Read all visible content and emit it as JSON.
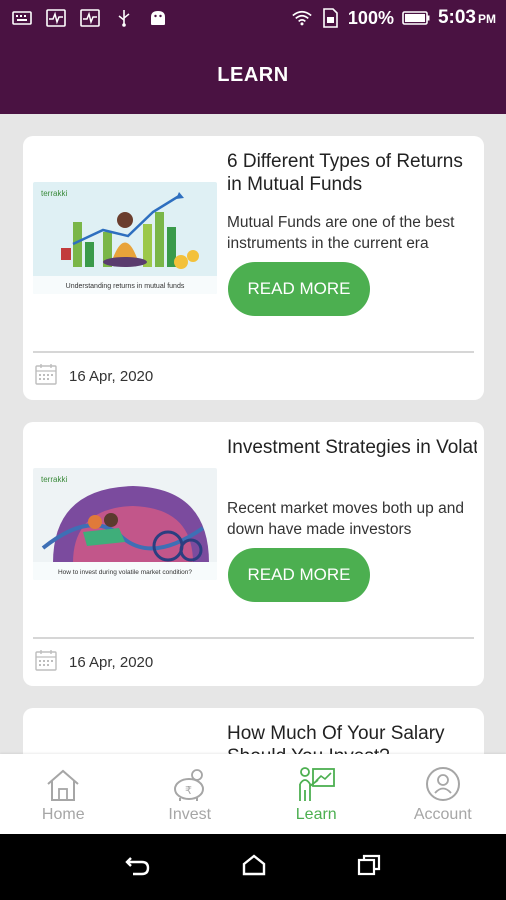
{
  "status_bar": {
    "battery": "100%",
    "time": "5:03",
    "ampm": "PM",
    "icons": [
      "keyboard-icon",
      "activity-icon",
      "activity-icon",
      "usb-icon",
      "android-icon",
      "wifi-icon",
      "sim-icon",
      "battery-icon"
    ]
  },
  "header": {
    "title": "LEARN"
  },
  "articles": [
    {
      "title": "6 Different Types of Returns in Mutual Funds",
      "description": "Mutual Funds are one of the best instruments in the current era",
      "cta": "READ MORE",
      "date": "16 Apr, 2020",
      "thumb": {
        "brand": "terrakki",
        "caption": "Understanding returns in mutual funds"
      }
    },
    {
      "title": "Investment Strategies in Volatile Stock Market C...",
      "description": "Recent market moves both up and down have made investors",
      "cta": "READ MORE",
      "date": "16 Apr, 2020",
      "thumb": {
        "brand": "terrakki",
        "caption": "How to invest during volatile market condition?"
      }
    },
    {
      "title": "How Much Of Your Salary Should You Invest?"
    }
  ],
  "bottom_nav": [
    {
      "label": "Home",
      "icon": "home-icon",
      "active": false
    },
    {
      "label": "Invest",
      "icon": "piggy-bank-icon",
      "active": false
    },
    {
      "label": "Learn",
      "icon": "learn-icon",
      "active": true
    },
    {
      "label": "Account",
      "icon": "account-icon",
      "active": false
    }
  ],
  "colors": {
    "primary": "#4a1242",
    "accent": "#4caf50",
    "inactive": "#a6a6a6"
  }
}
